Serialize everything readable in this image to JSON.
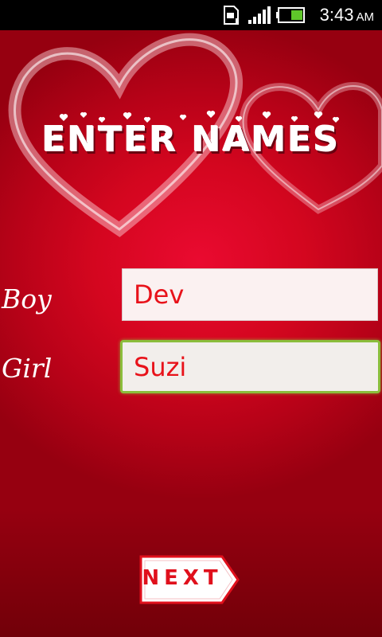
{
  "status_bar": {
    "time": "3:43",
    "ampm": "AM",
    "icons": [
      "sd-card-icon",
      "signal-icon",
      "battery-icon"
    ]
  },
  "title": "ENTER NAMES",
  "form": {
    "boy_label": "Boy",
    "boy_value": "Dev",
    "girl_label": "Girl",
    "girl_value": "Suzi"
  },
  "next_button": "NEXT",
  "colors": {
    "background_red": "#d4061f",
    "field_text": "#e8121a",
    "focus_border": "#8bbd3c"
  }
}
